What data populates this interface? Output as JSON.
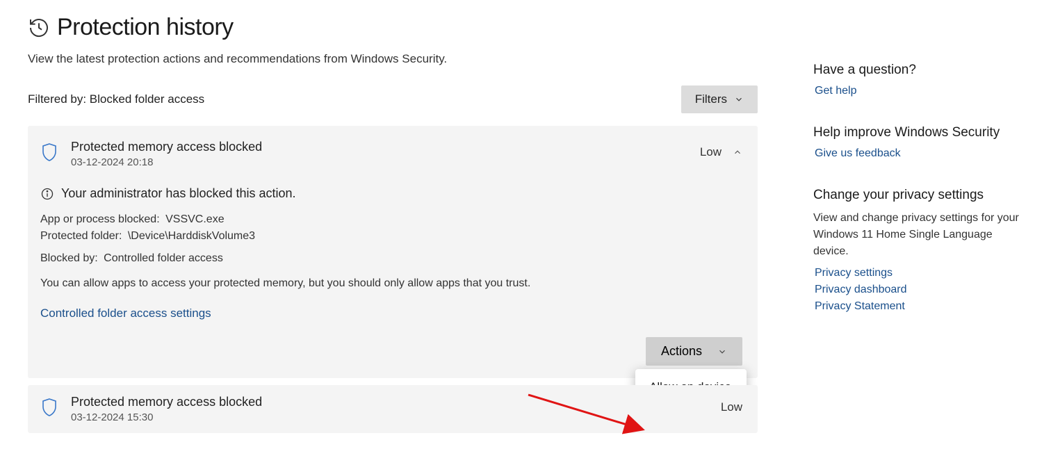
{
  "header": {
    "title": "Protection history",
    "subtitle": "View the latest protection actions and recommendations from Windows Security."
  },
  "filter": {
    "label": "Filtered by: Blocked folder access",
    "button": "Filters"
  },
  "events": [
    {
      "title": "Protected memory access blocked",
      "timestamp": "03-12-2024 20:18",
      "severity": "Low",
      "admin_message": "Your administrator has blocked this action.",
      "details": {
        "app_label": "App or process blocked:",
        "app_value": "VSSVC.exe",
        "folder_label": "Protected folder:",
        "folder_value": "\\Device\\HarddiskVolume3",
        "blocked_by_label": "Blocked by:",
        "blocked_by_value": "Controlled folder access"
      },
      "note": "You can allow apps to access your protected memory, but you should only allow apps that you trust.",
      "settings_link": "Controlled folder access settings",
      "actions_button": "Actions",
      "actions_menu": [
        "Allow on device"
      ]
    },
    {
      "title": "Protected memory access blocked",
      "timestamp": "03-12-2024 15:30",
      "severity": "Low"
    }
  ],
  "sidebar": {
    "question_heading": "Have a question?",
    "get_help": "Get help",
    "improve_heading": "Help improve Windows Security",
    "feedback": "Give us feedback",
    "privacy_heading": "Change your privacy settings",
    "privacy_text": "View and change privacy settings for your Windows 11 Home Single Language device.",
    "links": {
      "settings": "Privacy settings",
      "dashboard": "Privacy dashboard",
      "statement": "Privacy Statement"
    }
  }
}
